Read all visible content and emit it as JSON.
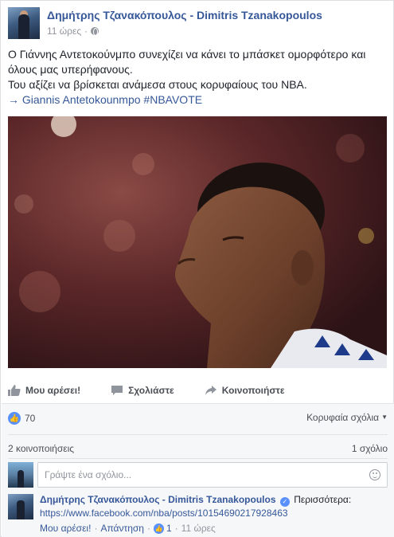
{
  "post": {
    "author": "Δημήτρης Τζανακόπουλος - Dimitris Tzanakopoulos",
    "time": "11 ώρες",
    "text_lines": [
      "Ο Γιάννης Αντετοκούνμπο συνεχίζει να κάνει το μπάσκετ ομορφότερο και",
      "όλους μας υπερήφανους.",
      "Του αξίζει να βρίσκεται ανάμεσα στους κορυφαίους του NBA."
    ],
    "link_text": "→ Giannis Antetokounmpo #NBAVOTE"
  },
  "actions": {
    "like": "Μου αρέσει!",
    "comment": "Σχολιάστε",
    "share": "Κοινοποιήστε"
  },
  "ufi": {
    "likes_count": "70",
    "top_comments": "Κορυφαία σχόλια",
    "shares": "2 κοινοποιήσεις",
    "comments_count": "1 σχόλιο",
    "composer_placeholder": "Γράψτε ένα σχόλιο..."
  },
  "comment": {
    "author": "Δημήτρης Τζανακόπουλος - Dimitris Tzanakopoulos",
    "more": "Περισσότερα:",
    "link": "https://www.facebook.com/nba/posts/10154690217928463",
    "like": "Μου αρέσει!",
    "reply": "Απάντηση",
    "likes": "1",
    "time": "11 ώρες"
  },
  "colors": {
    "link_blue": "#365899",
    "like_blue": "#5890ff"
  }
}
